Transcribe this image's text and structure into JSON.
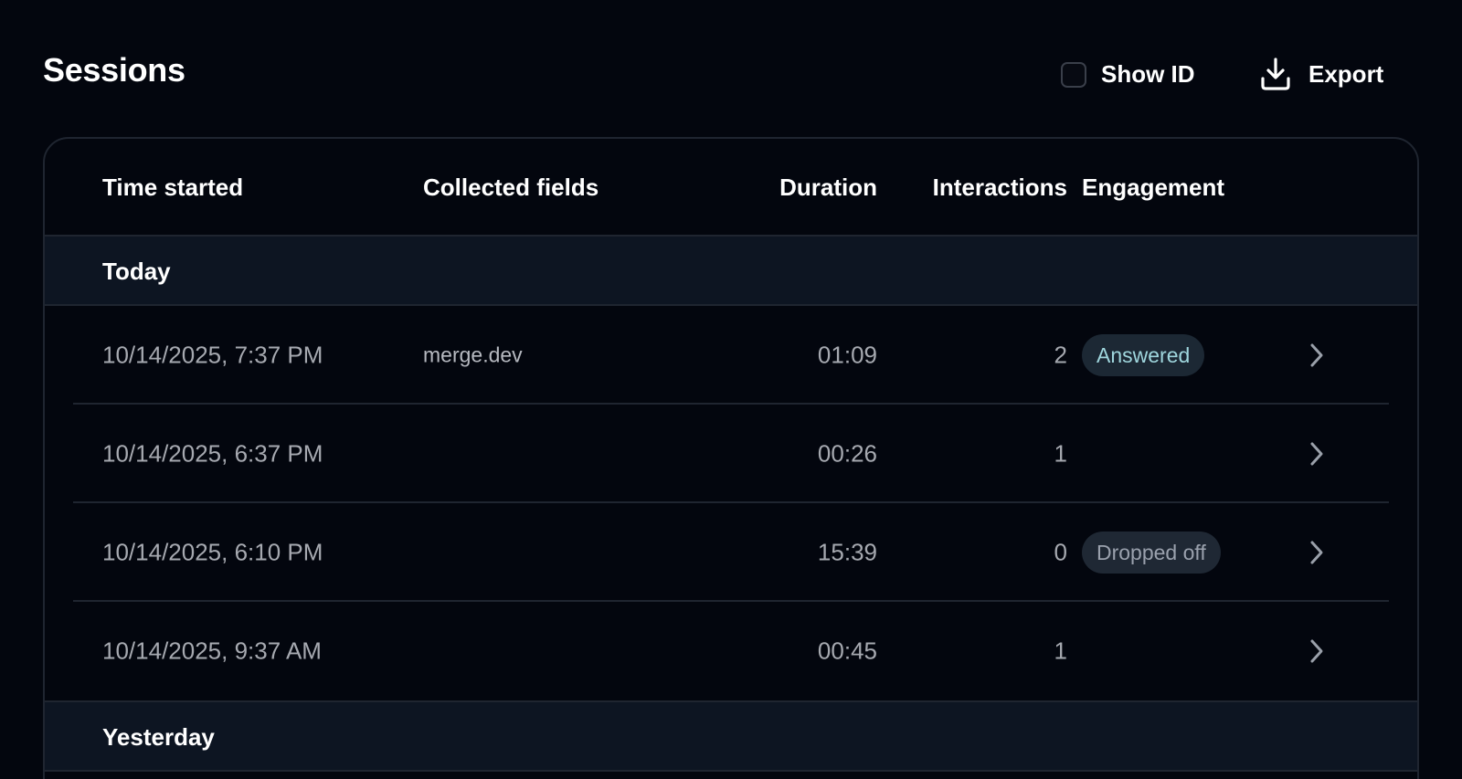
{
  "header": {
    "title": "Sessions",
    "show_id_label": "Show ID",
    "show_id_checked": false,
    "export_label": "Export",
    "export_icon": "download-tray-icon"
  },
  "table": {
    "columns": {
      "time_started": "Time started",
      "collected_fields": "Collected fields",
      "duration": "Duration",
      "interactions": "Interactions",
      "engagement": "Engagement"
    },
    "groups": [
      {
        "label": "Today",
        "rows": [
          {
            "time": "10/14/2025, 7:37 PM",
            "fields": "merge.dev",
            "duration": "01:09",
            "interactions": "2",
            "engagement": "Answered"
          },
          {
            "time": "10/14/2025, 6:37 PM",
            "fields": "",
            "duration": "00:26",
            "interactions": "1",
            "engagement": ""
          },
          {
            "time": "10/14/2025, 6:10 PM",
            "fields": "",
            "duration": "15:39",
            "interactions": "0",
            "engagement": "Dropped off"
          },
          {
            "time": "10/14/2025, 9:37 AM",
            "fields": "",
            "duration": "00:45",
            "interactions": "1",
            "engagement": ""
          }
        ]
      },
      {
        "label": "Yesterday",
        "rows": []
      }
    ],
    "row_icon": "chevron-right-icon"
  },
  "colors": {
    "background": "#03060e",
    "group_bg": "#0d1522",
    "border": "#1f2530",
    "answered_text": "#9fd6dd",
    "dropped_text": "#9aa1ad"
  }
}
